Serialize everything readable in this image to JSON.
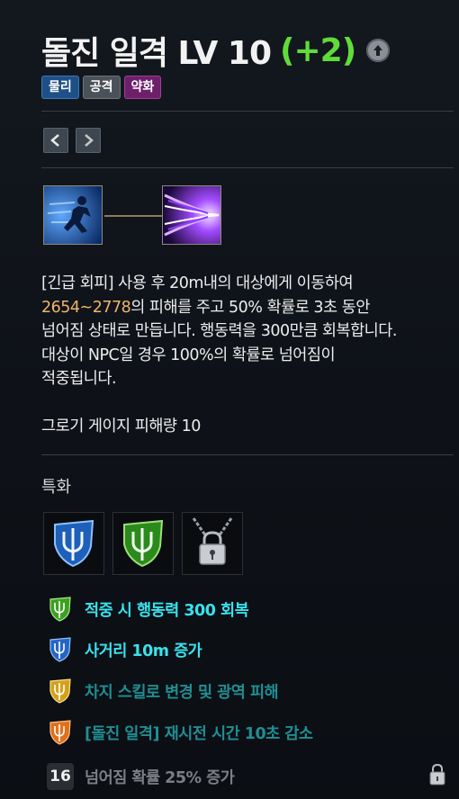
{
  "skill": {
    "name": "돌진 일격 LV 10",
    "bonus": "(+2)",
    "tags": [
      "물리",
      "공격",
      "약화"
    ]
  },
  "description": {
    "line1": "[긴급 회피] 사용 후 20m내의 대상에게 이동하여",
    "damage_range": "2654~2778",
    "line2_rest": "의 피해를 주고 50% 확률로 3초 동안",
    "line3": "넘어짐 상태로 만듭니다. 행동력을 300만큼 회복합니다.",
    "line4": "대상이 NPC일 경우 100%의 확률로 넘어짐이",
    "line5": "적중됩니다."
  },
  "gauge_damage": "그로기 게이지 피해량 10",
  "specialization": {
    "title": "특화",
    "effects": [
      {
        "text": "적중 시 행동력 300 회복",
        "icon": "green-trident-shield-icon"
      },
      {
        "text": "사거리 10m 증가",
        "icon": "blue-trident-shield-icon"
      },
      {
        "text": "차지 스킬로 변경 및 광역 피해",
        "icon": "gold-trident-shield-icon"
      },
      {
        "text": "[돌진 일격] 재시전 시간 10초 감소",
        "icon": "orange-trident-shield-icon"
      },
      {
        "text": "넘어짐 확률 25% 증가",
        "icon": "locked-level-icon"
      }
    ],
    "locked_level": "16"
  },
  "colors": {
    "bonus": "#5fdc3a",
    "damage_highlight": "#f0b46a",
    "effect_active": "#38e2ee",
    "effect_inactive": "#1f8f94",
    "effect_locked": "#7b7f85"
  }
}
